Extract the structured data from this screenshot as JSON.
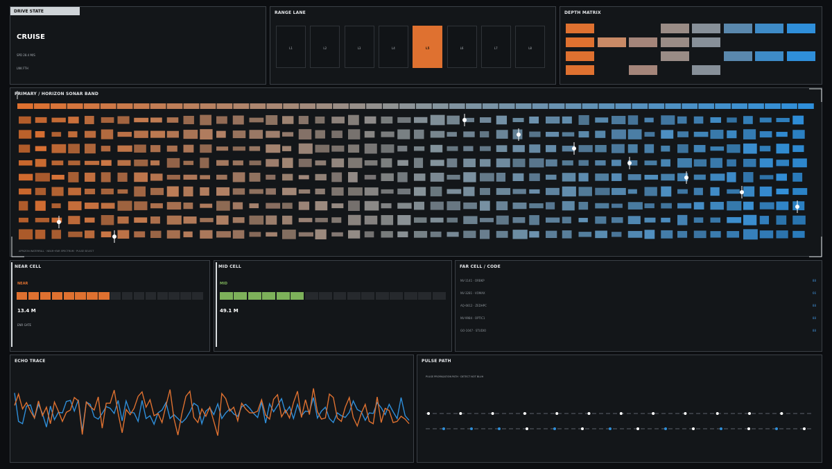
{
  "drive": {
    "title": "DRIVE STATE",
    "mode": "CRUISE",
    "speed": "SPD 28.4 M/S",
    "line2": "LNK FTH"
  },
  "range": {
    "title": "RANGE LANE",
    "lanes": [
      "L1",
      "L2",
      "L3",
      "L4",
      "L5",
      "L6",
      "L7",
      "L8"
    ],
    "active_index": 4
  },
  "depth": {
    "title": "DEPTH MATRIX",
    "cell_states": [
      [
        1,
        0,
        0,
        1,
        1,
        1,
        1,
        1
      ],
      [
        1,
        1,
        1,
        1,
        1,
        0,
        0,
        0
      ],
      [
        1,
        0,
        0,
        1,
        0,
        1,
        1,
        1
      ],
      [
        1,
        0,
        1,
        0,
        1,
        0,
        0,
        0
      ]
    ]
  },
  "sonar": {
    "title": "PRIMARY  /  HORIZON SONAR BAND",
    "footer": "APRIZON WATERFALL · NEAR→FAR SPECTRUM · PULSE SELECT"
  },
  "near": {
    "title": "NEAR CELL",
    "tag": "NEAR",
    "distance": "13.4 M",
    "sub": "ENR GATE",
    "level": 0.5
  },
  "mid": {
    "title": "MID CELL",
    "tag": "MID",
    "distance": "49.1 M",
    "level": 0.38
  },
  "far": {
    "title": "FAR CELL  /  CODE",
    "rows": [
      {
        "code": "NV-1141 · ORBKP",
        "value": "88"
      },
      {
        "code": "NV-3281 · VOMAX",
        "value": "66"
      },
      {
        "code": "AQ-6612 · ZEDHPC",
        "value": "88"
      },
      {
        "code": "NV-9984 · OPTIC1",
        "value": "88"
      },
      {
        "code": "GO-1047 · STUDIO",
        "value": "88"
      }
    ]
  },
  "echo": {
    "title": "ECHO TRACE",
    "series_orange": [
      0.58,
      0.78,
      0.52,
      0.63,
      0.48,
      0.36,
      0.66,
      0.4,
      0.55,
      0.26,
      0.64,
      0.48,
      0.3,
      0.46,
      0.5,
      0.72,
      0.66,
      0.07,
      0.64,
      0.56,
      0.5,
      0.73,
      0.18,
      0.62,
      0.62,
      0.85,
      0.44,
      0.1,
      0.51,
      0.42,
      0.53,
      0.74,
      0.82,
      0.55,
      0.68,
      0.4,
      0.44,
      0.28,
      0.58,
      0.86,
      0.35,
      0.06,
      0.44,
      0.74,
      0.83,
      0.37,
      0.28,
      0.52,
      0.39,
      0.55,
      0.3,
      0.05,
      0.79,
      0.7,
      0.48,
      0.55,
      0.31,
      0.62,
      0.52,
      0.45,
      0.45,
      0.48,
      0.68,
      0.41,
      0.34,
      0.69,
      0.77,
      0.38,
      0.5,
      0.36,
      0.63,
      0.83,
      0.37,
      0.68,
      0.42,
      0.88,
      0.47,
      0.34,
      0.36,
      0.78,
      0.72,
      0.36,
      0.3,
      0.55,
      0.72,
      0.37,
      0.22,
      0.44,
      0.6,
      0.3,
      0.26,
      0.73,
      0.28,
      0.53,
      0.49,
      0.28,
      0.3,
      0.39,
      0.34,
      0.26
    ],
    "series_blue": [
      0.8,
      0.3,
      0.26,
      0.57,
      0.59,
      0.36,
      0.6,
      0.44,
      0.2,
      0.57,
      0.33,
      0.46,
      0.45,
      0.65,
      0.67,
      0.48,
      0.68,
      0.13,
      0.64,
      0.6,
      0.38,
      0.34,
      0.44,
      0.56,
      0.53,
      0.44,
      0.67,
      0.31,
      0.66,
      0.46,
      0.45,
      0.3,
      0.67,
      0.35,
      0.4,
      0.25,
      0.45,
      0.5,
      0.63,
      0.35,
      0.42,
      0.35,
      0.28,
      0.35,
      0.47,
      0.62,
      0.57,
      0.26,
      0.48,
      0.54,
      0.42,
      0.61,
      0.35,
      0.45,
      0.52,
      0.43,
      0.39,
      0.56,
      0.6,
      0.53,
      0.44,
      0.37,
      0.64,
      0.27,
      0.61,
      0.47,
      0.58,
      0.7,
      0.45,
      0.56,
      0.35,
      0.6,
      0.4,
      0.48,
      0.47,
      0.72,
      0.36,
      0.48,
      0.55,
      0.35,
      0.28,
      0.45,
      0.4,
      0.37,
      0.46,
      0.66,
      0.51,
      0.47,
      0.32,
      0.45,
      0.44,
      0.63,
      0.54,
      0.42,
      0.6,
      0.47,
      0.35,
      0.72,
      0.4,
      0.32
    ]
  },
  "pulse": {
    "title": "PULSE PATH",
    "caption": "PULSE PROPAGATION PATH · DETECT NOT BLUH",
    "row1": [
      "w",
      "w",
      "w",
      "w",
      "w",
      "w",
      "w",
      "w",
      "w",
      "w",
      "w",
      "w"
    ],
    "row2": [
      "b",
      "b",
      "b",
      "w",
      "b",
      "w",
      "b",
      "w",
      "b",
      "w",
      "b",
      "w",
      "b",
      "w"
    ]
  },
  "colors": {
    "orange": "#df7130",
    "blue": "#2f8fda",
    "green": "#7db15a",
    "panel_bg": "#131619",
    "border": "#3b4046"
  }
}
